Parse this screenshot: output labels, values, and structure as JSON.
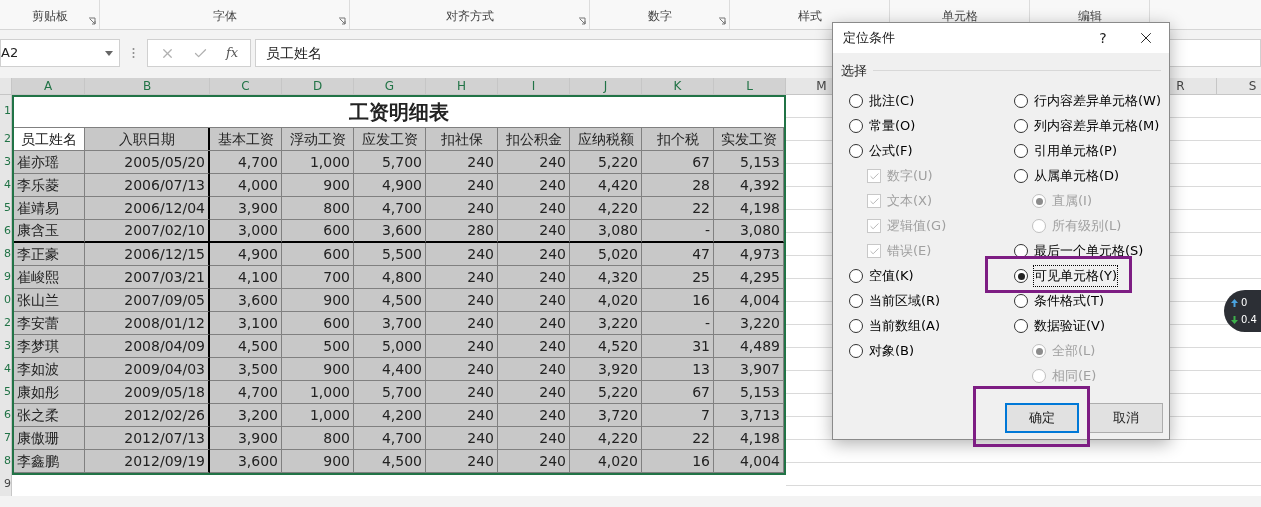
{
  "ribbon": {
    "groups": [
      "剪贴板",
      "字体",
      "对齐方式",
      "数字",
      "样式",
      "单元格",
      "编辑"
    ]
  },
  "formula_bar": {
    "name_box": "A2",
    "formula": "员工姓名",
    "function_label": "fx"
  },
  "sheet": {
    "column_headers": [
      "A",
      "B",
      "C",
      "D",
      "G",
      "H",
      "I",
      "J",
      "K",
      "L",
      "M",
      "R",
      "S"
    ],
    "title": {
      "row_label": "1",
      "text": "工资明细表"
    },
    "header": {
      "row_label": "2",
      "cells": [
        {
          "text": "员工姓名",
          "selected": true
        },
        {
          "text": "入职日期",
          "selected": false
        },
        {
          "text": "基本工资",
          "selected": false
        },
        {
          "text": "浮动工资",
          "selected": false
        },
        {
          "text": "应发工资",
          "selected": false
        },
        {
          "text": "扣社保",
          "selected": false
        },
        {
          "text": "扣公积金",
          "selected": false
        },
        {
          "text": "应纳税额",
          "selected": false
        },
        {
          "text": "扣个税",
          "selected": false
        },
        {
          "text": "实发工资",
          "selected": false
        }
      ]
    },
    "rows": [
      {
        "row_label": "3",
        "thick_border": false,
        "cells": [
          "崔亦瑶",
          "2005/05/20",
          "4,700",
          "1,000",
          "5,700",
          "240",
          "240",
          "5,220",
          "67",
          "5,153"
        ]
      },
      {
        "row_label": "4",
        "thick_border": false,
        "cells": [
          "李乐菱",
          "2006/07/13",
          "4,000",
          "900",
          "4,900",
          "240",
          "240",
          "4,420",
          "28",
          "4,392"
        ]
      },
      {
        "row_label": "5",
        "thick_border": false,
        "cells": [
          "崔靖易",
          "2006/12/04",
          "3,900",
          "800",
          "4,700",
          "240",
          "240",
          "4,220",
          "22",
          "4,198"
        ]
      },
      {
        "row_label": "6",
        "thick_border": true,
        "cells": [
          "康含玉",
          "2007/02/10",
          "3,000",
          "600",
          "3,600",
          "280",
          "240",
          "3,080",
          "-",
          "3,080"
        ]
      },
      {
        "row_label": "8",
        "thick_border": false,
        "cells": [
          "李正豪",
          "2006/12/15",
          "4,900",
          "600",
          "5,500",
          "240",
          "240",
          "5,020",
          "47",
          "4,973"
        ]
      },
      {
        "row_label": "9",
        "thick_border": false,
        "cells": [
          "崔峻熙",
          "2007/03/21",
          "4,100",
          "700",
          "4,800",
          "240",
          "240",
          "4,320",
          "25",
          "4,295"
        ]
      },
      {
        "row_label": "0",
        "thick_border": false,
        "cells": [
          "张山兰",
          "2007/09/05",
          "3,600",
          "900",
          "4,500",
          "240",
          "240",
          "4,020",
          "16",
          "4,004"
        ]
      },
      {
        "row_label": "2",
        "thick_border": false,
        "cells": [
          "李安蕾",
          "2008/01/12",
          "3,100",
          "600",
          "3,700",
          "240",
          "240",
          "3,220",
          "-",
          "3,220"
        ]
      },
      {
        "row_label": "3",
        "thick_border": false,
        "cells": [
          "李梦琪",
          "2008/04/09",
          "4,500",
          "500",
          "5,000",
          "240",
          "240",
          "4,520",
          "31",
          "4,489"
        ]
      },
      {
        "row_label": "4",
        "thick_border": false,
        "cells": [
          "李如波",
          "2009/04/03",
          "3,500",
          "900",
          "4,400",
          "240",
          "240",
          "3,920",
          "13",
          "3,907"
        ]
      },
      {
        "row_label": "5",
        "thick_border": false,
        "cells": [
          "康如彤",
          "2009/05/18",
          "4,700",
          "1,000",
          "5,700",
          "240",
          "240",
          "5,220",
          "67",
          "5,153"
        ]
      },
      {
        "row_label": "6",
        "thick_border": false,
        "cells": [
          "张之柔",
          "2012/02/26",
          "3,200",
          "1,000",
          "4,200",
          "240",
          "240",
          "3,720",
          "7",
          "3,713"
        ]
      },
      {
        "row_label": "7",
        "thick_border": false,
        "cells": [
          "康傲珊",
          "2012/07/13",
          "3,900",
          "800",
          "4,700",
          "240",
          "240",
          "4,220",
          "22",
          "4,198"
        ]
      },
      {
        "row_label": "8",
        "thick_border": false,
        "cells": [
          "李鑫鹏",
          "2012/09/19",
          "3,600",
          "900",
          "4,500",
          "240",
          "240",
          "4,020",
          "16",
          "4,004"
        ]
      }
    ],
    "empty_rows": [
      "9"
    ]
  },
  "dialog": {
    "title": "定位条件",
    "help": "?",
    "group_label": "选择",
    "left_options": [
      {
        "kind": "radio",
        "label": "批注(C)",
        "selected": false,
        "disabled": false
      },
      {
        "kind": "radio",
        "label": "常量(O)",
        "selected": false,
        "disabled": false
      },
      {
        "kind": "radio",
        "label": "公式(F)",
        "selected": false,
        "disabled": false,
        "children": [
          {
            "kind": "check",
            "label": "数字(U)",
            "checked": true,
            "disabled": true
          },
          {
            "kind": "check",
            "label": "文本(X)",
            "checked": true,
            "disabled": true
          },
          {
            "kind": "check",
            "label": "逻辑值(G)",
            "checked": true,
            "disabled": true
          },
          {
            "kind": "check",
            "label": "错误(E)",
            "checked": true,
            "disabled": true
          }
        ]
      },
      {
        "kind": "radio",
        "label": "空值(K)",
        "selected": false,
        "disabled": false
      },
      {
        "kind": "radio",
        "label": "当前区域(R)",
        "selected": false,
        "disabled": false
      },
      {
        "kind": "radio",
        "label": "当前数组(A)",
        "selected": false,
        "disabled": false
      },
      {
        "kind": "radio",
        "label": "对象(B)",
        "selected": false,
        "disabled": false
      }
    ],
    "right_options": [
      {
        "kind": "radio",
        "label": "行内容差异单元格(W)",
        "selected": false,
        "disabled": false
      },
      {
        "kind": "radio",
        "label": "列内容差异单元格(M)",
        "selected": false,
        "disabled": false
      },
      {
        "kind": "radio",
        "label": "引用单元格(P)",
        "selected": false,
        "disabled": false
      },
      {
        "kind": "radio",
        "label": "从属单元格(D)",
        "selected": false,
        "disabled": false,
        "children": [
          {
            "kind": "radio",
            "label": "直属(I)",
            "selected": true,
            "disabled": true
          },
          {
            "kind": "radio",
            "label": "所有级别(L)",
            "selected": false,
            "disabled": true
          }
        ]
      },
      {
        "kind": "radio",
        "label": "最后一个单元格(S)",
        "selected": false,
        "disabled": false
      },
      {
        "kind": "radio",
        "label": "可见单元格(Y)",
        "selected": true,
        "disabled": false
      },
      {
        "kind": "radio",
        "label": "条件格式(T)",
        "selected": false,
        "disabled": false
      },
      {
        "kind": "radio",
        "label": "数据验证(V)",
        "selected": false,
        "disabled": false,
        "children": [
          {
            "kind": "radio",
            "label": "全部(L)",
            "selected": true,
            "disabled": true
          },
          {
            "kind": "radio",
            "label": "相同(E)",
            "selected": false,
            "disabled": true
          }
        ]
      }
    ],
    "buttons": [
      {
        "label": "确定",
        "selected": true
      },
      {
        "label": "取消",
        "selected": false
      }
    ]
  },
  "speed_widget": {
    "up": "0",
    "down": "0.4"
  }
}
